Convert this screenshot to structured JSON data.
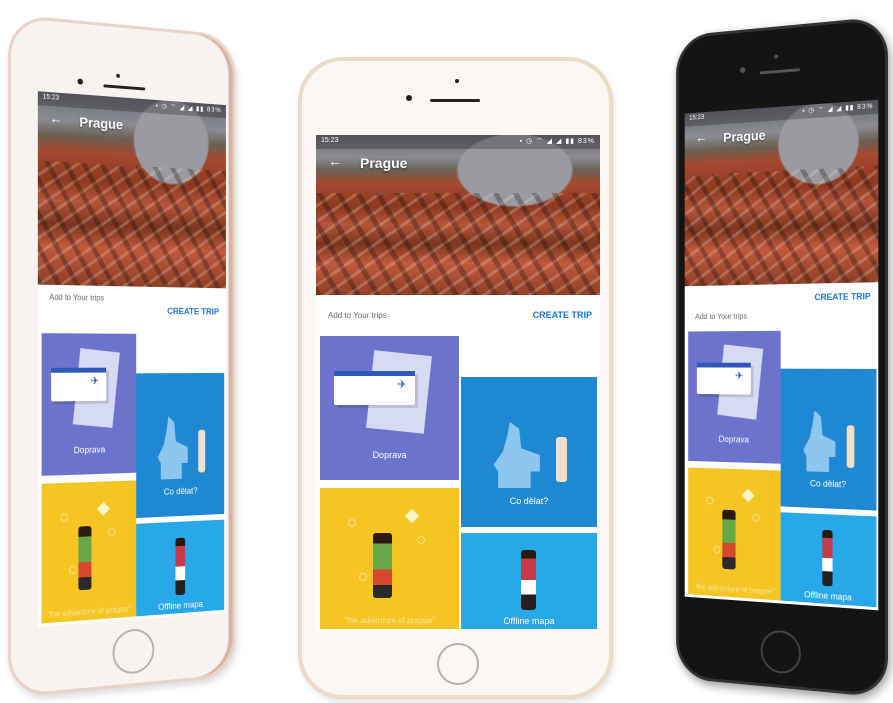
{
  "app": {
    "status_time": "15:23",
    "status_icons": "▪ ◷ ⌔ ◢ ◢ ▮▮ 83%",
    "city_title": "Prague",
    "add_to_trips_label": "Add to Your trips",
    "create_trip_label": "CREATE TRIP",
    "tiles": [
      {
        "id": "transport",
        "label": "Doprava",
        "color": "#6b73cc"
      },
      {
        "id": "todo",
        "label": "Co dělat?",
        "color": "#1e88d2"
      },
      {
        "id": "adventure",
        "label": "\"the adventure of prague\"",
        "color": "#f5c524"
      },
      {
        "id": "maps",
        "label": "Offline mapa",
        "color": "#29a8e8"
      }
    ]
  },
  "icons": {
    "back": "arrow-left-icon",
    "plane": "airplane-icon",
    "home": "home-button-icon"
  }
}
